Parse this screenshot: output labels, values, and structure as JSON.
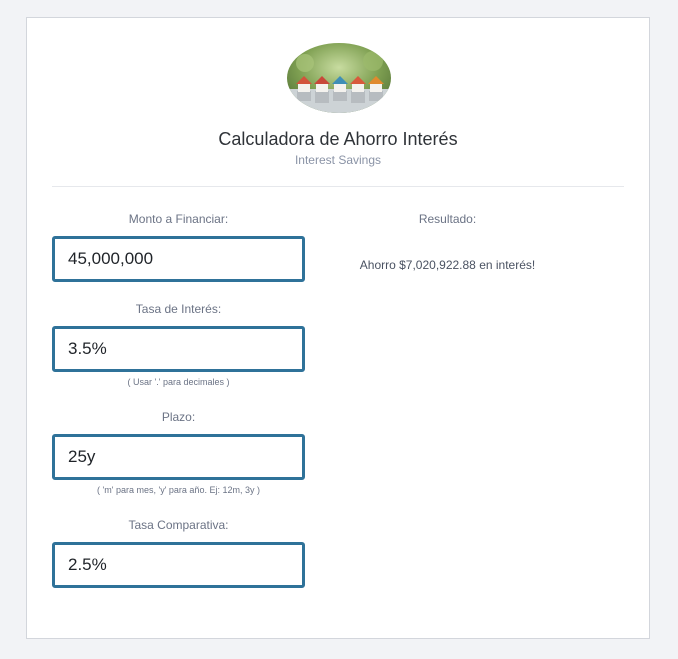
{
  "header": {
    "title": "Calculadora de Ahorro Interés",
    "subtitle": "Interest Savings",
    "logo_icon": "houses-on-coins-image"
  },
  "form": {
    "amount": {
      "label": "Monto a Financiar:",
      "value": "45,000,000"
    },
    "rate": {
      "label": "Tasa de Interés:",
      "value": "3.5%",
      "hint": "( Usar '.' para decimales )"
    },
    "term": {
      "label": "Plazo:",
      "value": "25y",
      "hint": "( 'm' para mes, 'y' para año. Ej: 12m, 3y )"
    },
    "compare_rate": {
      "label": "Tasa Comparativa:",
      "value": "2.5%"
    }
  },
  "result": {
    "label": "Resultado:",
    "text": "Ahorro $7,020,922.88 en interés!"
  },
  "colors": {
    "input_border": "#2f7299",
    "background": "#f2f3f6",
    "card": "#ffffff"
  }
}
